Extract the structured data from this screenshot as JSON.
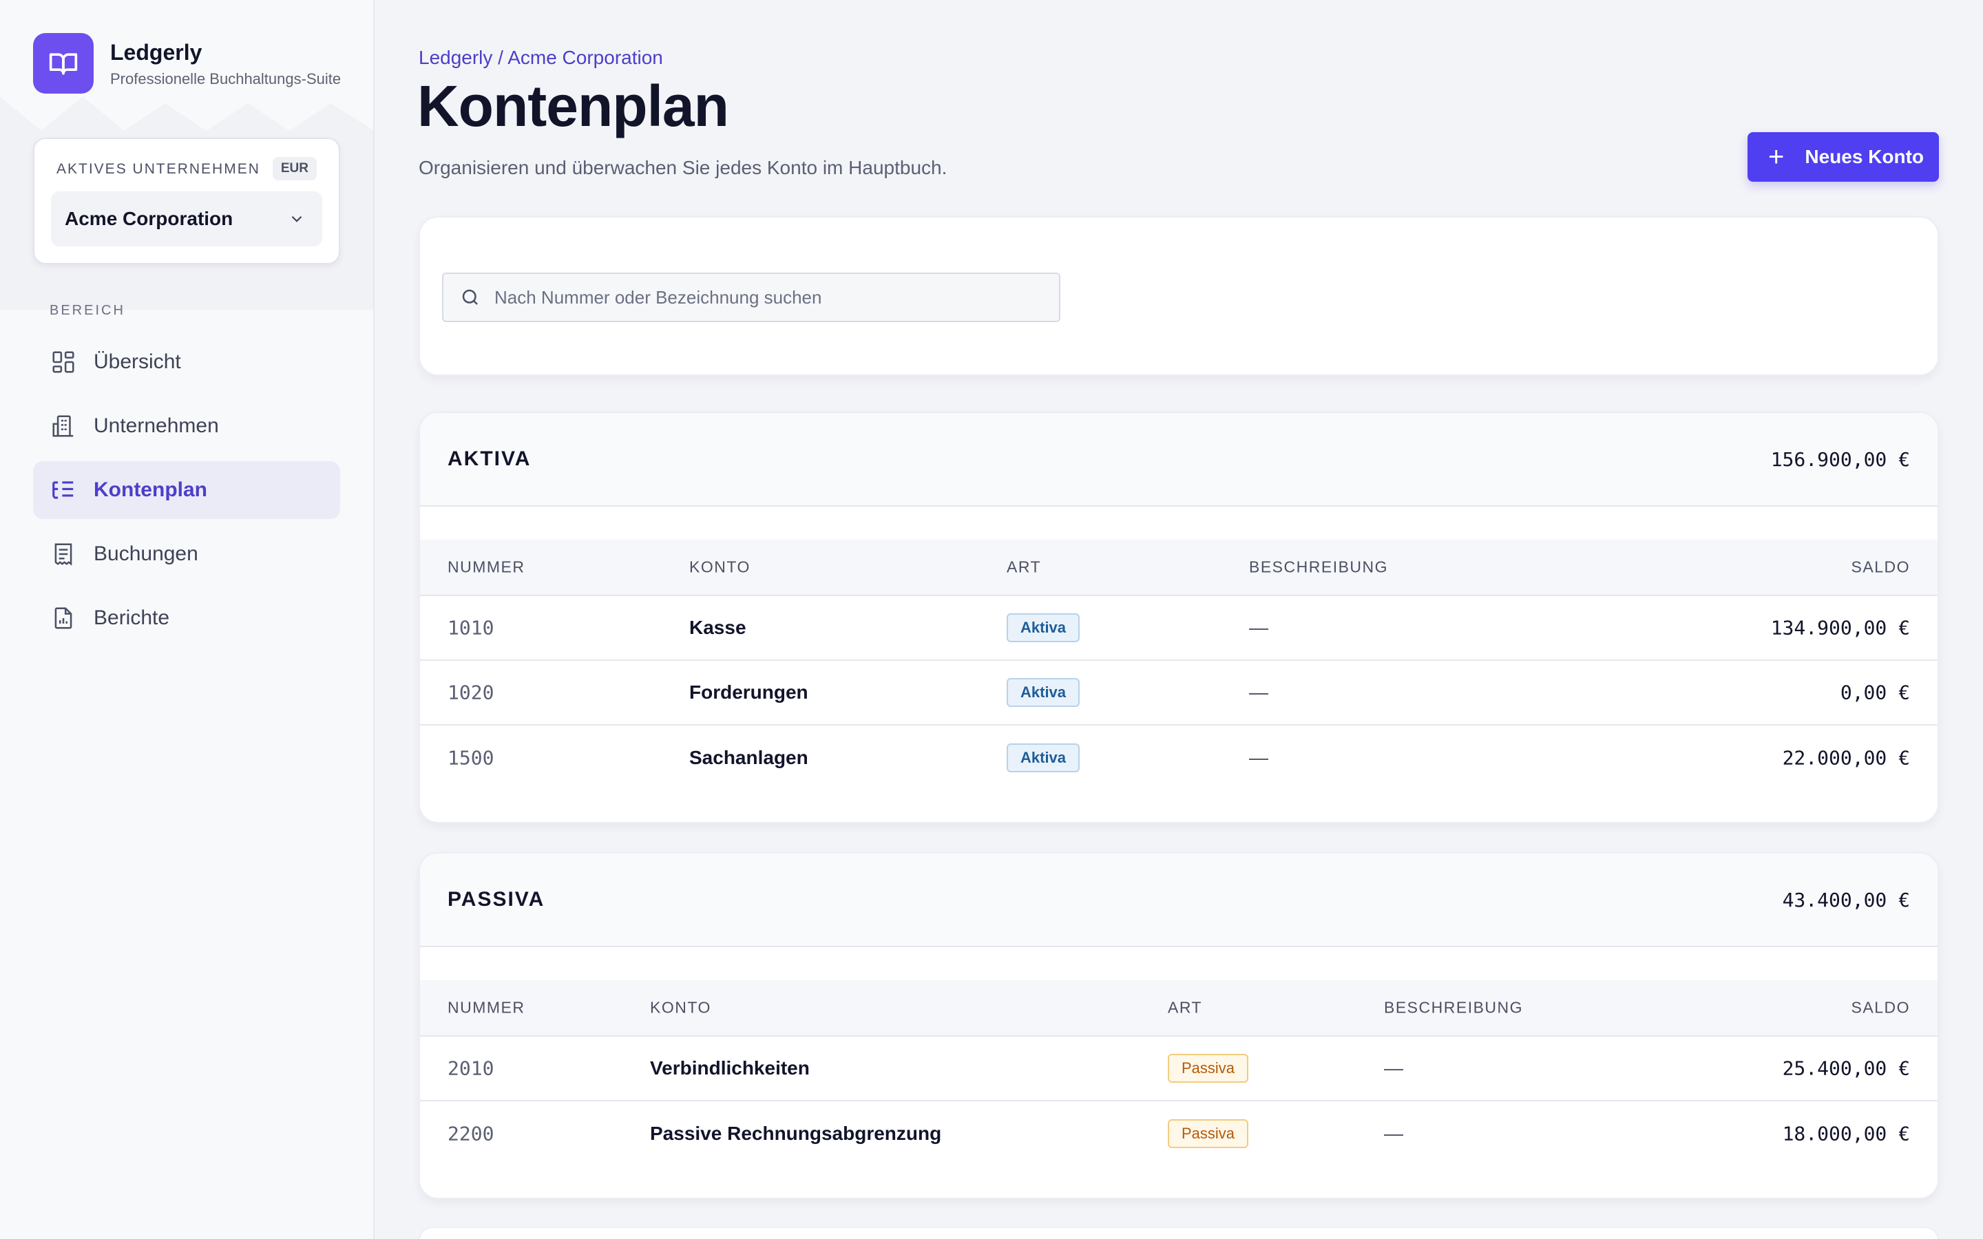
{
  "brand": {
    "name": "Ledgerly",
    "subtitle": "Professionelle Buchhaltungs-Suite"
  },
  "company": {
    "label": "AKTIVES UNTERNEHMEN",
    "currency": "EUR",
    "selected": "Acme Corporation"
  },
  "nav": {
    "section": "BEREICH",
    "items": [
      {
        "label": "Übersicht",
        "icon": "dashboard-icon"
      },
      {
        "label": "Unternehmen",
        "icon": "building-icon"
      },
      {
        "label": "Kontenplan",
        "icon": "list-tree-icon",
        "active": true
      },
      {
        "label": "Buchungen",
        "icon": "receipt-icon"
      },
      {
        "label": "Berichte",
        "icon": "report-icon"
      }
    ]
  },
  "header": {
    "breadcrumb": "Ledgerly / Acme Corporation",
    "title": "Kontenplan",
    "subtitle": "Organisieren und überwachen Sie jedes Konto im Hauptbuch.",
    "new_button": "Neues Konto"
  },
  "search": {
    "placeholder": "Nach Nummer oder Bezeichnung suchen"
  },
  "groups": [
    {
      "title": "AKTIVA",
      "total": "156.900,00 €",
      "columns": [
        "NUMMER",
        "KONTO",
        "ART",
        "BESCHREIBUNG",
        "SALDO"
      ],
      "rows": [
        {
          "number": "1010",
          "account": "Kasse",
          "type": "Aktiva",
          "description": "—",
          "balance": "134.900,00 €"
        },
        {
          "number": "1020",
          "account": "Forderungen",
          "type": "Aktiva",
          "description": "—",
          "balance": "0,00 €"
        },
        {
          "number": "1500",
          "account": "Sachanlagen",
          "type": "Aktiva",
          "description": "—",
          "balance": "22.000,00 €"
        }
      ]
    },
    {
      "title": "PASSIVA",
      "total": "43.400,00 €",
      "columns": [
        "NUMMER",
        "KONTO",
        "ART",
        "BESCHREIBUNG",
        "SALDO"
      ],
      "rows": [
        {
          "number": "2010",
          "account": "Verbindlichkeiten",
          "type": "Passiva",
          "description": "—",
          "balance": "25.400,00 €"
        },
        {
          "number": "2200",
          "account": "Passive Rechnungsabgrenzung",
          "type": "Passiva",
          "description": "—",
          "balance": "18.000,00 €"
        }
      ]
    }
  ],
  "colors": {
    "accent": "#4f3ff0",
    "brand": "#6d4ff0",
    "active_nav": "#4d3ec9"
  }
}
